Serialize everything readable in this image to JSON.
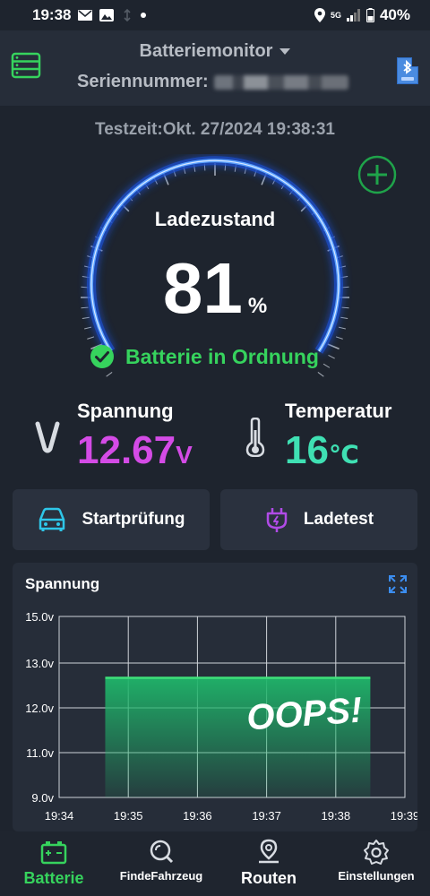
{
  "statusbar": {
    "time": "19:38",
    "signal": "5G",
    "battery": "40%"
  },
  "header": {
    "title": "Batteriemonitor",
    "serial_label": "Seriennummer:"
  },
  "test_time": "Testzeit:Okt. 27/2024 19:38:31",
  "gauge": {
    "label": "Ladezustand",
    "value": "81",
    "unit": "%",
    "status": "Batterie in Ordnung"
  },
  "voltage": {
    "label": "Spannung",
    "value": "12.67",
    "unit": "V"
  },
  "temperature": {
    "label": "Temperatur",
    "value": "16",
    "unit": "℃"
  },
  "actions": {
    "start_test": "Startprüfung",
    "charge_test": "Ladetest"
  },
  "chart": {
    "title": "Spannung",
    "overlay_text": "OOPS!"
  },
  "chart_data": {
    "type": "area",
    "title": "Spannung",
    "x": [
      "19:34",
      "19:35",
      "19:36",
      "19:37",
      "19:38",
      "19:39"
    ],
    "y_ticks": [
      "15.0v",
      "13.0v",
      "12.0v",
      "11.0v",
      "9.0v"
    ],
    "series": [
      {
        "x_start": "19:34:40",
        "x_end": "19:38:30",
        "values": [
          12.67,
          12.67,
          12.67,
          12.67,
          12.67
        ]
      }
    ],
    "grid": true
  },
  "nav": [
    {
      "label": "Batterie",
      "icon": "battery-icon",
      "active": true
    },
    {
      "label": "FindeFahrzeug",
      "icon": "search-icon",
      "active": false
    },
    {
      "label": "Routen",
      "icon": "location-pin-icon",
      "active": false
    },
    {
      "label": "Einstellungen",
      "icon": "gear-icon",
      "active": false
    }
  ],
  "colors": {
    "accent_green": "#36d35d",
    "voltage": "#d44be6",
    "temperature": "#3fe0b3",
    "gauge_blue": "#3b7cff"
  }
}
